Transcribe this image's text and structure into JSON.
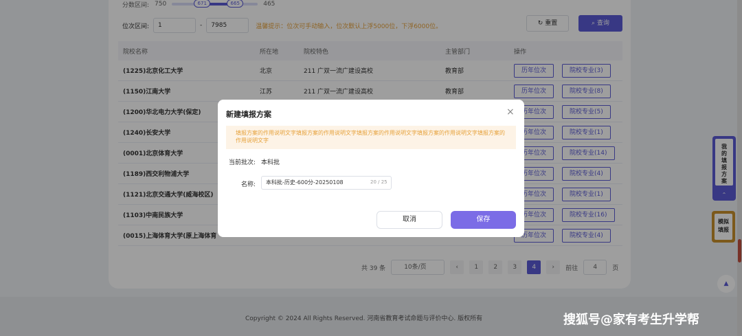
{
  "filters": {
    "score_label": "分数区间:",
    "score_min": "750",
    "score_knob_left": "671",
    "score_knob_right": "665",
    "score_max": "465",
    "rank_label": "位次区间:",
    "rank_from": "1",
    "rank_to": "7985",
    "rank_sep": "-",
    "hint": "温馨提示：位次可手动输入，位次默认上浮5000位，下浮6000位。",
    "reset": "重置",
    "query": "查询"
  },
  "table": {
    "headers": [
      "院校名称",
      "所在地",
      "院校特色",
      "主管部门",
      "操作"
    ],
    "history_btn": "历年位次",
    "rows": [
      {
        "name": "(1225)北京化工大学",
        "loc": "北京",
        "feature": "211 广双一流广建设高校",
        "dept": "教育部",
        "major": "院校专业(3)"
      },
      {
        "name": "(1150)江南大学",
        "loc": "江苏",
        "feature": "211 广双一流广建设高校",
        "dept": "教育部",
        "major": "院校专业(8)"
      },
      {
        "name": "(1200)华北电力大学(保定)",
        "loc": "",
        "feature": "",
        "dept": "",
        "major": "院校专业(5)"
      },
      {
        "name": "(1240)长安大学",
        "loc": "",
        "feature": "",
        "dept": "",
        "major": "院校专业(1)"
      },
      {
        "name": "(0001)北京体育大学",
        "loc": "",
        "feature": "",
        "dept": "",
        "major": "院校专业(14)"
      },
      {
        "name": "(1189)西交利物浦大学",
        "loc": "",
        "feature": "",
        "dept": "",
        "major": "院校专业(4)"
      },
      {
        "name": "(1121)北京交通大学(威海校区)",
        "loc": "",
        "feature": "",
        "dept": "",
        "major": "院校专业(1)"
      },
      {
        "name": "(1103)中南民族大学",
        "loc": "",
        "feature": "",
        "dept": "",
        "major": "院校专业(16)"
      },
      {
        "name": "(0015)上海体育大学(原上海体育",
        "loc": "",
        "feature": "",
        "dept": "",
        "major": "院校专业(4)"
      }
    ]
  },
  "pager": {
    "total": "共 39 条",
    "size": "10条/页",
    "pages": [
      "1",
      "2",
      "3",
      "4"
    ],
    "active_page": "4",
    "prev": "‹",
    "next": "›",
    "goto_label": "前往",
    "goto_value": "4",
    "goto_suffix": "页"
  },
  "footer": {
    "copyright": "Copyright © 2024 All Rights Reserved. 河南省教育考试命题与评价中心. 版权所有",
    "watermark": "搜狐号@家有考生升学帮"
  },
  "side": {
    "my_plan": "我的填报方案",
    "mock": "模拟填报"
  },
  "modal": {
    "title": "新建填报方案",
    "close": "×",
    "notice": "填报方案的作用说明文字填报方案的作用说明文字填报方案的作用说明文字填报方案的作用说明文字填报方案的作用说明文字",
    "batch_label": "当前批次:",
    "batch_value": "本科批",
    "name_label": "名称:",
    "name_value": "本科批-历史-600分-20250108",
    "name_count": "20 / 25",
    "cancel": "取消",
    "save": "保存"
  },
  "colors": {
    "accent": "#5b5bd6",
    "save": "#7b6ce6",
    "warning": "#e6a23c",
    "mock_border": "#c8902c"
  }
}
